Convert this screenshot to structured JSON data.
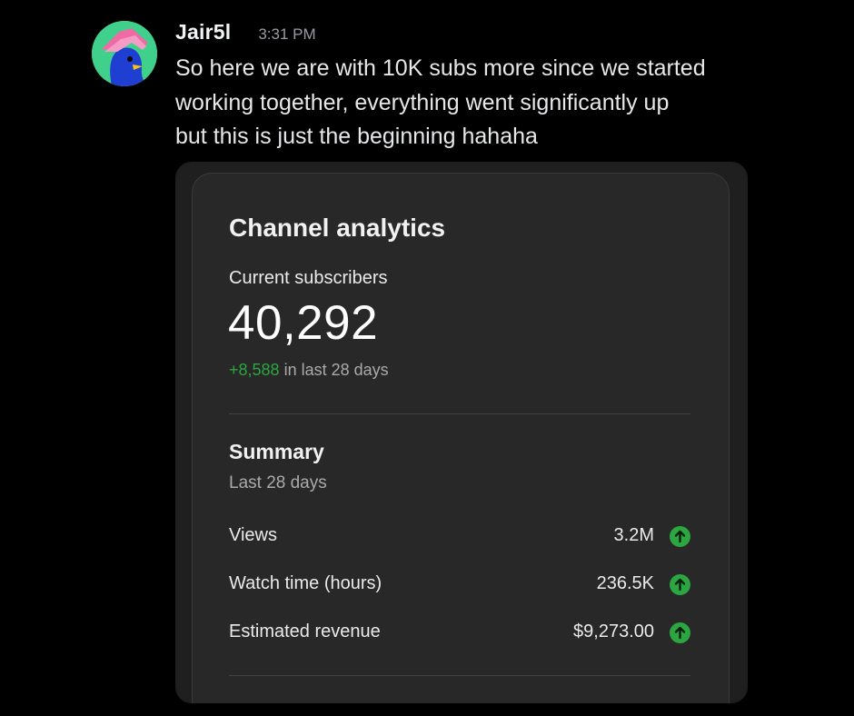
{
  "message": {
    "username": "Jair5l",
    "timestamp": "3:31 PM",
    "lines": [
      "So here we are with 10K subs more since we started",
      "working together, everything went significantly up",
      "but this is just the beginning  hahaha"
    ]
  },
  "analytics": {
    "title": "Channel analytics",
    "subscribers_label": "Current subscribers",
    "subscribers_count": "40,292",
    "subscribers_delta": "+8,588",
    "subscribers_period": " in last 28 days",
    "summary_title": "Summary",
    "summary_period": "Last 28 days",
    "metrics": [
      {
        "label": "Views",
        "value": "3.2M",
        "trend": "up-arrow-icon"
      },
      {
        "label": "Watch time (hours)",
        "value": "236.5K",
        "trend": "up-arrow-icon"
      },
      {
        "label": "Estimated revenue",
        "value": "$9,273.00",
        "trend": "up-arrow-icon"
      }
    ]
  },
  "colors": {
    "background": "#000000",
    "card": "#282828",
    "positive": "#2ba640",
    "avatar_bg": "#3fd18b"
  }
}
